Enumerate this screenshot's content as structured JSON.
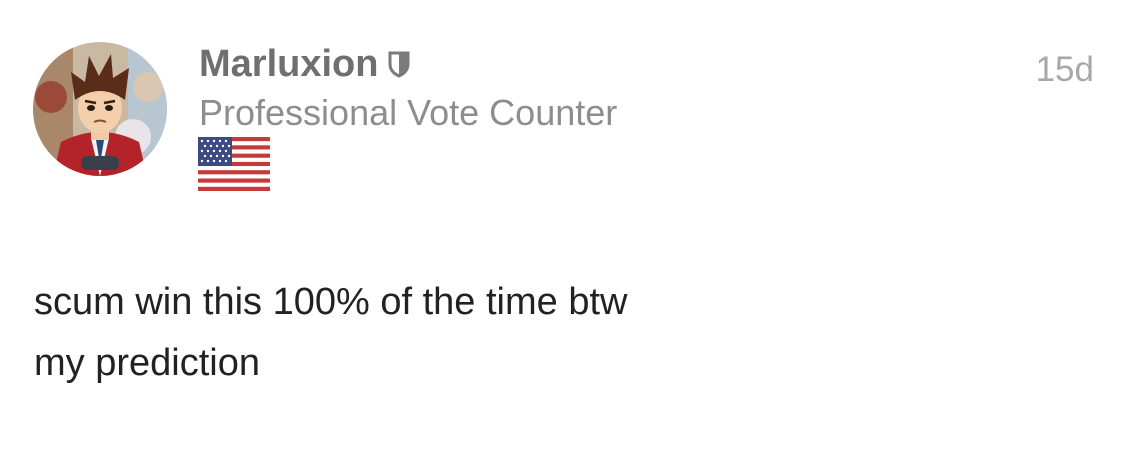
{
  "post": {
    "author": {
      "username": "Marluxion",
      "title": "Professional Vote Counter",
      "avatar_icon": "user-avatar",
      "badge_icon": "moderator-shield-icon",
      "flag_icon": "us-flag-icon"
    },
    "timestamp": "15d",
    "body_lines": [
      "scum win this 100% of the time btw",
      "my prediction"
    ]
  },
  "colors": {
    "username": "#6f6f6f",
    "title": "#8d8d8d",
    "timestamp": "#a8a8a8",
    "body_text": "#222222",
    "background": "#ffffff"
  }
}
